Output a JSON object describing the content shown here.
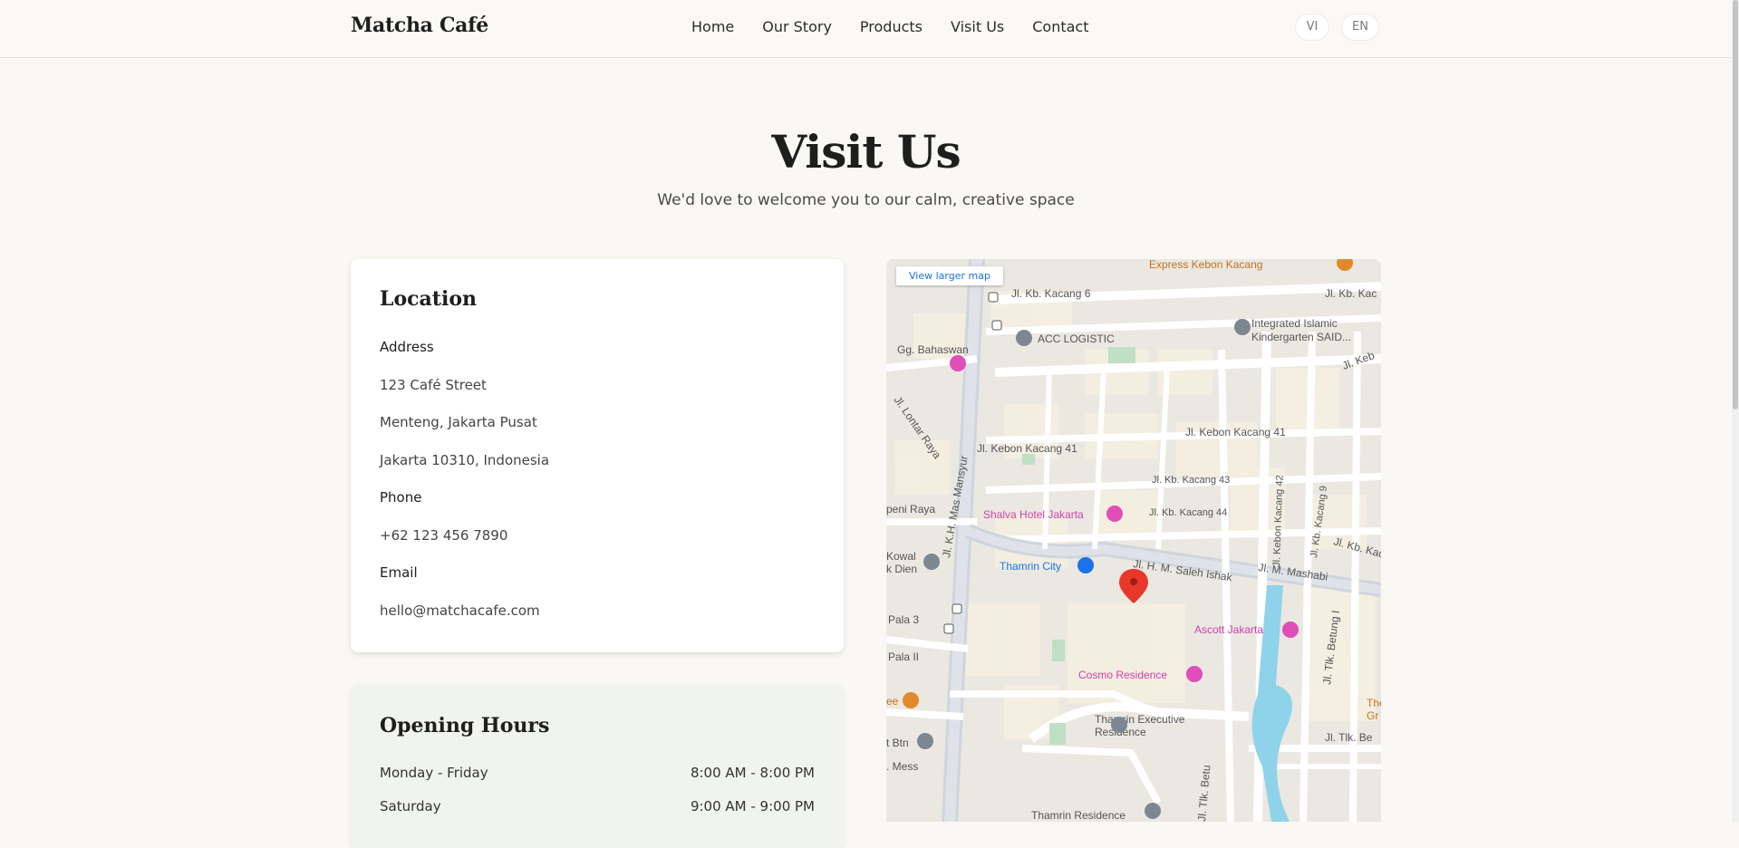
{
  "nav": {
    "brand": "Matcha Café",
    "links": [
      "Home",
      "Our Story",
      "Products",
      "Visit Us",
      "Contact"
    ],
    "lang_vi": "VI",
    "lang_en": "EN"
  },
  "hero": {
    "title": "Visit Us",
    "subtitle": "We'd love to welcome you to our calm, creative space"
  },
  "location": {
    "heading": "Location",
    "address_label": "Address",
    "address_lines": [
      "123 Café Street",
      "Menteng, Jakarta Pusat",
      "Jakarta 10310, Indonesia"
    ],
    "phone_label": "Phone",
    "phone": "+62 123 456 7890",
    "email_label": "Email",
    "email": "hello@matchacafe.com"
  },
  "hours": {
    "heading": "Opening Hours",
    "rows": [
      {
        "day": "Monday - Friday",
        "time": "8:00 AM - 8:00 PM"
      },
      {
        "day": "Saturday",
        "time": "9:00 AM - 9:00 PM"
      }
    ]
  },
  "map": {
    "view_larger": "View larger map",
    "labels": {
      "express": "Express Kebon Kacang",
      "kacang6": "Jl. Kb. Kacang 6",
      "kbkac": "Jl. Kb. Kac",
      "acc": "ACC LOGISTIC",
      "islamic1": "Integrated Islamic",
      "islamic2": "Kindergarten SAID...",
      "gg": "Gg. Bahaswan",
      "jlkeb": "Jl. Keb",
      "lontar": "Jl. Lontar Raya",
      "mansyur": "Jl. K.H. Mas Mansyur",
      "kk41a": "Jl. Kebon Kacang 41",
      "kk41b": "Jl. Kebon Kacang 41",
      "kk43": "Jl. Kb. Kacang 43",
      "kk42": "Jl. Kebon Kacang 42",
      "kk9": "Jl. Kb. Kacang 9",
      "shalva": "Shalva Hotel Jakarta",
      "kk44": "Jl. Kb. Kacang 44",
      "peni": "peni Raya",
      "kbkaca": "Jl. Kb. Kaca",
      "kowal": "Kowal",
      "dien": "k Dien",
      "thamrin": "Thamrin City",
      "saleh": "Jl. H. M. Saleh Ishak",
      "mashabi": "Jl. M. Mashabi",
      "pala3": "Pala 3",
      "ascott": "Ascott Jakarta",
      "pala2": "Pala II",
      "cosmo": "Cosmo Residence",
      "ee": "ee",
      "theg1": "The",
      "theg2": "Gr",
      "tex1": "Thamrin Executive",
      "tex2": "Residence",
      "btn": "t Btn",
      "tlkbe": "Jl. Tlk. Be",
      "tlkbetung": "Jl. Tlk. Betung I",
      "mess": ". Mess",
      "tlkbetu": "Jl. Tlk. Betu",
      "tres": "Thamrin Residence"
    }
  }
}
